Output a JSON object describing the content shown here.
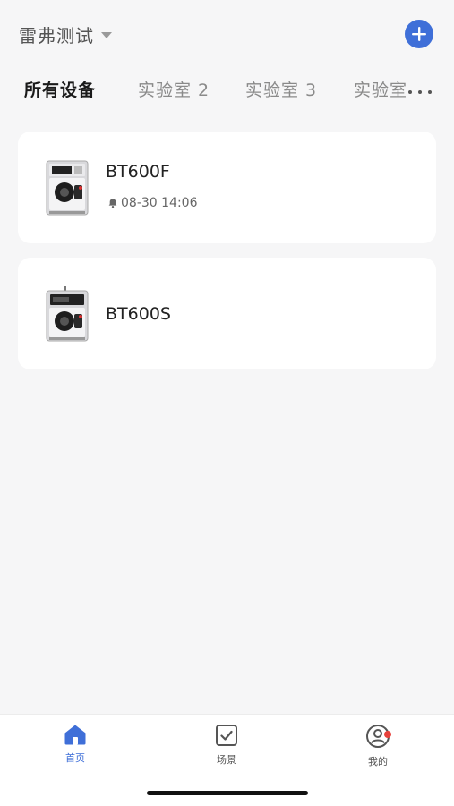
{
  "header": {
    "home_name": "雷弗测试"
  },
  "tabs": [
    {
      "label": "所有设备",
      "active": true
    },
    {
      "label": "实验室 2",
      "active": false
    },
    {
      "label": "实验室 3",
      "active": false
    },
    {
      "label": "实验室",
      "active": false
    }
  ],
  "devices": [
    {
      "name": "BT600F",
      "alarm_time": "08-30 14:06"
    },
    {
      "name": "BT600S",
      "alarm_time": ""
    }
  ],
  "tabbar": {
    "home_label": "首页",
    "scene_label": "场景",
    "mine_label": "我的"
  },
  "colors": {
    "accent": "#3f6fd8",
    "badge": "#e8413b",
    "background": "#f6f6f7"
  }
}
